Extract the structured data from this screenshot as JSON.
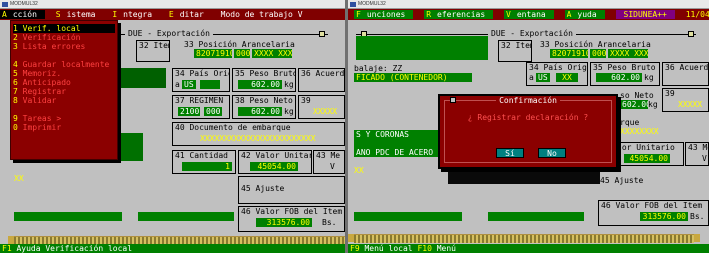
{
  "left": {
    "window_title": "MODMUL32",
    "menu": [
      {
        "hot": "A",
        "rest": "cción"
      },
      {
        "hot": "S",
        "rest": "istema"
      },
      {
        "hot": "I",
        "rest": "ntegra"
      },
      {
        "hot": "E",
        "rest": "ditar"
      },
      {
        "hot": "",
        "rest": "Modo de trabajo  V"
      }
    ],
    "frame_title": "DUE - Exportación",
    "dropdown_items": [
      {
        "num": "1",
        "label": "Verif. local",
        "selected": true
      },
      {
        "num": "2",
        "label": "Verificación",
        "selected": false
      },
      {
        "num": "3",
        "label": "Lista errores",
        "selected": false
      },
      {
        "sep": true
      },
      {
        "num": "4",
        "label": "Guardar localmente",
        "selected": false
      },
      {
        "num": "5",
        "label": "Memoriz.",
        "selected": false
      },
      {
        "num": "6",
        "label": "Anticipado",
        "selected": false
      },
      {
        "num": "7",
        "label": "Registrar",
        "selected": false
      },
      {
        "num": "8",
        "label": "Validar",
        "selected": false
      },
      {
        "sep": true
      },
      {
        "num": "9",
        "label": "Tareas            >",
        "selected": false
      },
      {
        "num": "0",
        "label": "Imprimir",
        "selected": false
      }
    ],
    "fields": {
      "item_label": "32 Item",
      "posicion_label": "33 Posición Arancelaria",
      "posicion_value": "82071910",
      "posicion_ext1": "000",
      "posicion_ext2": "XXXX XXXX",
      "pais_label": "34 País Orig.",
      "pais_a": "a",
      "pais_value": "US",
      "peso_bruto_label": "35 Peso Bruto",
      "peso_bruto_value": "602.00",
      "kg1": "kg",
      "acuerdo_label": "36 Acuerd",
      "regimen_label": "37 REGIMEN",
      "regimen_value": "2100",
      "regimen_ext": "000",
      "peso_neto_label": "38 Peso Neto",
      "peso_neto_value": "602.00",
      "kg2": "kg",
      "c39_label": "39",
      "c39_value": "XXXXX",
      "doc_label": "40 Documento de embarque",
      "doc_value": "XXXXXXXXXXXXXXXXXXXXXXXX",
      "cantidad_label": "41 Cantidad",
      "cantidad_value": "1",
      "valor_label": "42 Valor Unitario",
      "valor_value": "45054.00",
      "c43_label": "43 Me",
      "c43_v": "V",
      "ajuste_label": "45 Ajuste",
      "fob_label": "46 Valor FOB del Item",
      "fob_value": "313576.00",
      "bs": "Bs.",
      "xx": "XX"
    },
    "status": {
      "hot": "F1",
      "text": " Ayuda  Verificación local"
    }
  },
  "right": {
    "window_title": "MODMUL32",
    "menu": [
      {
        "hot": "F",
        "rest": "unciones"
      },
      {
        "hot": "R",
        "rest": "eferencias"
      },
      {
        "hot": "V",
        "rest": "entana"
      },
      {
        "hot": "A",
        "rest": "yuda"
      }
    ],
    "menu_extra": "SIDUNEA++",
    "menu_date": "11/04/2018 17:31:1",
    "frame_title": "DUE - Exportación",
    "fields": {
      "item_label": "32 Item",
      "posicion_label": "33 Posición Arancelaria",
      "posicion_value": "82071910",
      "posicion_ext1": "000",
      "posicion_ext2": "XXXX XXXX",
      "embalaje": "balaje: ZZ",
      "embalaje2": "FICADO (CONTENEDOR)",
      "pais_label": "34 País Orig.",
      "pais_a": "a",
      "pais_value": "US",
      "pais_xx": "XX",
      "peso_bruto_label": "35 Peso Bruto",
      "peso_bruto_value": "602.00",
      "kg1": "kg",
      "acuerdo_label": "36 Acuerd",
      "peso_neto_label": "so Neto",
      "peso_neto_value": "602.00",
      "kg2": "kg",
      "c39_label": "39",
      "c39_value": "XXXXX",
      "rque": "rque",
      "rque_value": "XXXXXXXX",
      "coronas": "S Y CORONAS",
      "acero": "ANO PDC DE ACERO",
      "valor_label": "lor Unitario",
      "valor_value": "45054.00",
      "c43_label": "43 Me",
      "c43_v": "V",
      "ajuste_label": "45 Ajuste",
      "fob_label": "46 Valor FOB del Item",
      "fob_value": "313576.00",
      "bs": "Bs.",
      "xx": "XX"
    },
    "dialog": {
      "title": "Confirmación",
      "question": "¿ Registrar declaración ?",
      "yes": "Sí",
      "no": "No"
    },
    "status": {
      "hot1": "F9",
      "text1": " Menú local  ",
      "hot2": "F10",
      "text2": " Menú"
    }
  }
}
